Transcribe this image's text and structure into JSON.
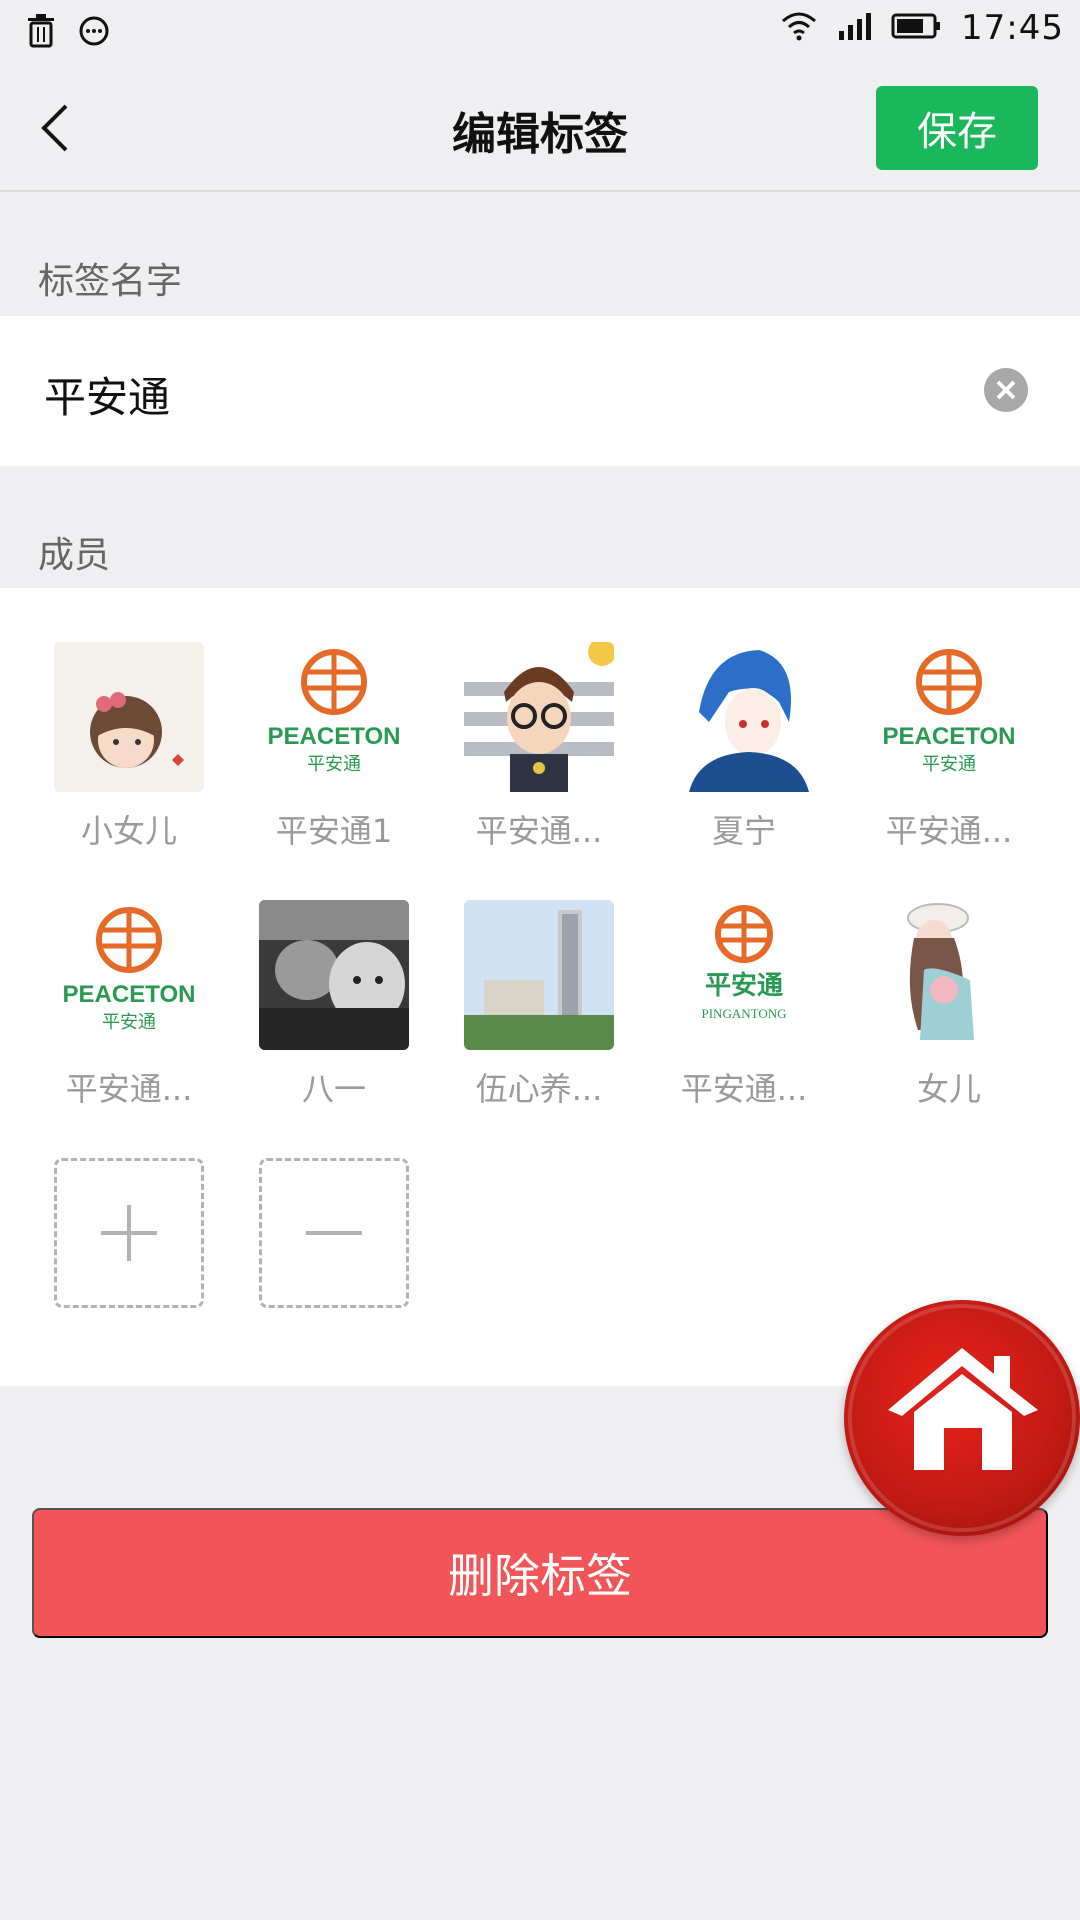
{
  "status_bar": {
    "time": "17:45",
    "icons": [
      "trash-icon",
      "chat-icon",
      "wifi-icon",
      "signal-icon",
      "battery-icon"
    ]
  },
  "navbar": {
    "title": "编辑标签",
    "save_label": "保存"
  },
  "tag_name": {
    "section_label": "标签名字",
    "value": "平安通"
  },
  "members": {
    "section_label": "成员",
    "items": [
      {
        "label": "小女儿"
      },
      {
        "label": "平安通1"
      },
      {
        "label": "平安通..."
      },
      {
        "label": "夏宁"
      },
      {
        "label": "平安通..."
      },
      {
        "label": "平安通..."
      },
      {
        "label": "八一"
      },
      {
        "label": "伍心养..."
      },
      {
        "label": "平安通..."
      },
      {
        "label": "女儿"
      }
    ],
    "peaceton_text": "PEACETON",
    "peaceton_cn": "平安通",
    "pingantong_en": "PINGANTONG"
  },
  "delete_label": "删除标签",
  "colors": {
    "save_green": "#1bb85b",
    "delete_red": "#f25558",
    "home_red": "#d8201a",
    "logo_orange": "#e56a27",
    "logo_green": "#2a9a52"
  }
}
